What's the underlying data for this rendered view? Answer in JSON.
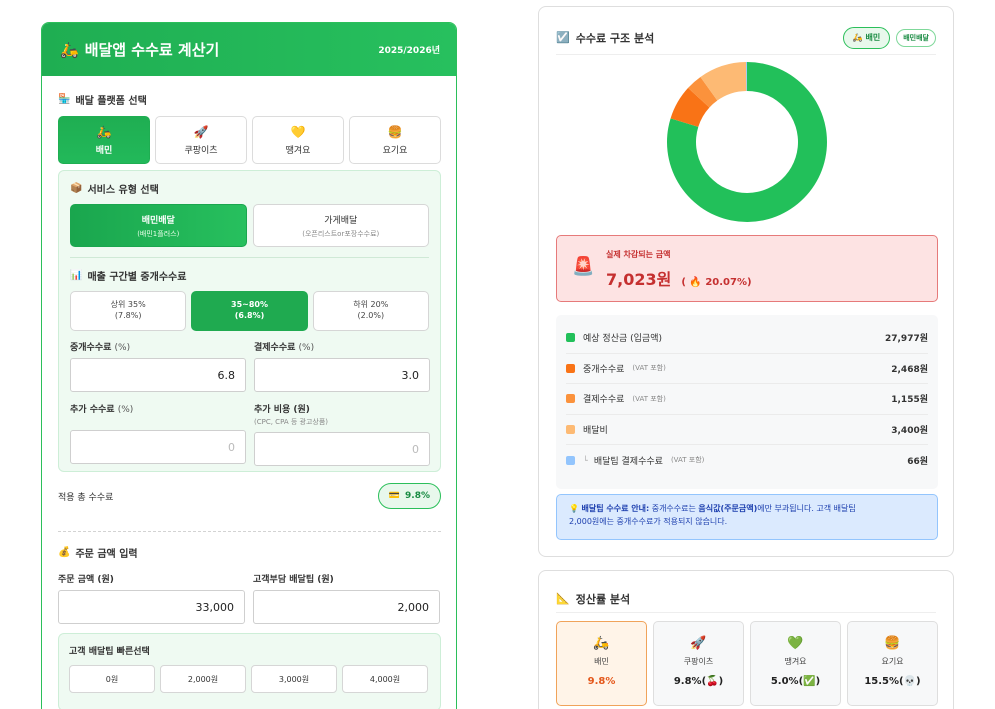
{
  "calculator": {
    "title": "배달앱 수수료 계산기",
    "year": "2025/2026년",
    "platform_section": "배달 플랫폼 선택",
    "platforms": [
      {
        "icon": "🛵",
        "label": "배민",
        "active": true
      },
      {
        "icon": "🚀",
        "label": "쿠팡이츠",
        "active": false
      },
      {
        "icon": "💛",
        "label": "땡겨요",
        "active": false
      },
      {
        "icon": "🍔",
        "label": "요기요",
        "active": false
      }
    ],
    "service_section": "서비스 유형 선택",
    "services": [
      {
        "label": "배민배달",
        "sub": "(배민1플러스)",
        "active": true
      },
      {
        "label": "가게배달",
        "sub": "(오픈리스트or포장수수료)",
        "active": false
      }
    ],
    "tier_section": "매출 구간별 중개수수료",
    "tiers": [
      {
        "line1": "상위 35%",
        "line2": "(7.8%)",
        "active": false
      },
      {
        "line1": "35~80%",
        "line2": "(6.8%)",
        "active": true
      },
      {
        "line1": "하위 20%",
        "line2": "(2.0%)",
        "active": false
      }
    ],
    "fields": {
      "commission_label": "중개수수료",
      "commission_unit": "(%)",
      "commission_value": "6.8",
      "payment_label": "결제수수료",
      "payment_unit": "(%)",
      "payment_value": "3.0",
      "extra_fee_label": "추가 수수료",
      "extra_fee_unit": "(%)",
      "extra_fee_placeholder": "0",
      "extra_cost_label": "추가 비용 (원)",
      "extra_cost_sub": "(CPC, CPA 등 광고상품)",
      "extra_cost_placeholder": "0"
    },
    "total_label": "적용 총 수수료",
    "total_value": "9.8%",
    "order_section": "주문 금액 입력",
    "order_amount_label": "주문 금액 (원)",
    "order_amount_value": "33,000",
    "delivery_tip_label": "고객부담 배달팁 (원)",
    "delivery_tip_value": "2,000",
    "quick_section": "고객 배달팁 빠른선택",
    "quick_options": [
      "0원",
      "2,000원",
      "3,000원",
      "4,000원"
    ]
  },
  "analysis": {
    "title": "수수료 구조 분석",
    "tag_platform": "배민",
    "tag_service": "배민배달",
    "alert_label": "실제 차감되는 금액",
    "alert_value": "7,023원",
    "alert_percent": "20.07%",
    "breakdown": [
      {
        "label": "예상 정산금 (입금액)",
        "vat": "",
        "amount": "27,977원",
        "color": "#22c05a",
        "sub": false
      },
      {
        "label": "중개수수료",
        "vat": "(VAT 포함)",
        "amount": "2,468원",
        "color": "#f97316",
        "sub": false
      },
      {
        "label": "결제수수료",
        "vat": "(VAT 포함)",
        "amount": "1,155원",
        "color": "#fb923c",
        "sub": false
      },
      {
        "label": "배달비",
        "vat": "",
        "amount": "3,400원",
        "color": "#fdba74",
        "sub": false
      },
      {
        "label": "배달팁 결제수수료",
        "vat": "(VAT 포함)",
        "amount": "66원",
        "color": "#93c5fd",
        "sub": true
      }
    ],
    "info_bold": "배달팁 수수료 안내:",
    "info_text1": " 중개수수료는 ",
    "info_bold2": "음식값(주문금액)",
    "info_text2": "에만 부과됩니다. 고객 배달팁",
    "info_text3": "2,000원에는 중개수수료가 적용되지 않습니다.",
    "chart_data": {
      "type": "pie",
      "donut": true,
      "categories": [
        "예상 정산금 (입금액)",
        "중개수수료",
        "결제수수료",
        "배달비",
        "배달팁 결제수수료"
      ],
      "values": [
        27977,
        2468,
        1155,
        3400,
        66
      ],
      "colors": [
        "#22c05a",
        "#f97316",
        "#fb923c",
        "#fdba74",
        "#93c5fd"
      ]
    }
  },
  "rates": {
    "title": "정산률 분석",
    "items": [
      {
        "icon": "🛵",
        "label": "배민",
        "value": "9.8%",
        "active": true
      },
      {
        "icon": "🚀",
        "label": "쿠팡이츠",
        "value": "9.8%(🍒)",
        "active": false
      },
      {
        "icon": "💚",
        "label": "땡겨요",
        "value": "5.0%(✅)",
        "active": false
      },
      {
        "icon": "🍔",
        "label": "요기요",
        "value": "15.5%(💀)",
        "active": false
      }
    ]
  },
  "colors": {
    "accent": "#1fae52",
    "danger": "#c53030",
    "info": "#1e40af"
  }
}
